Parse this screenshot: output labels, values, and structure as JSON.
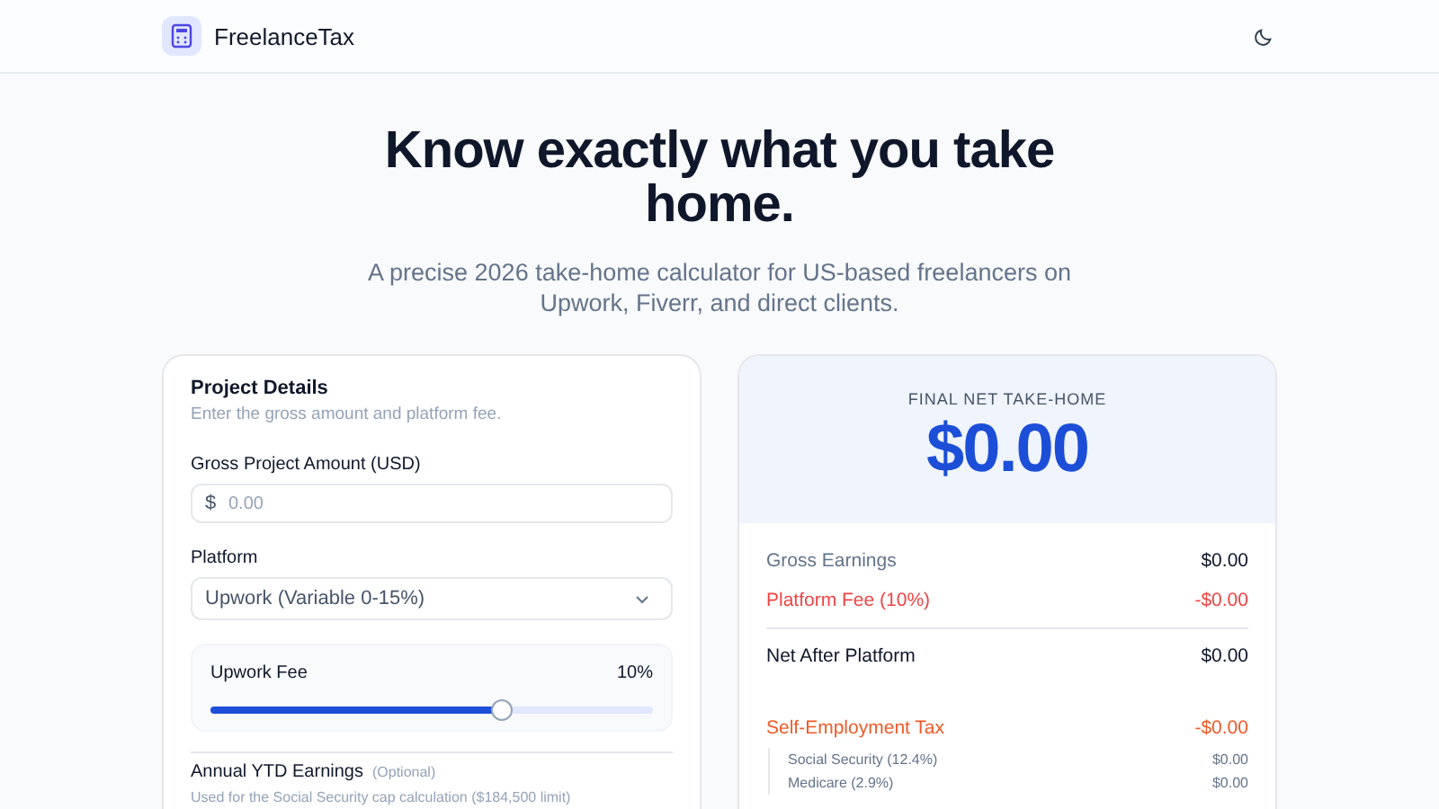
{
  "header": {
    "brand": "FreelanceTax"
  },
  "hero": {
    "title": "Know exactly what you take home.",
    "subtitle": "A precise 2026 take-home calculator for US-based freelancers on Upwork, Fiverr, and direct clients."
  },
  "details": {
    "title": "Project Details",
    "subtitle": "Enter the gross amount and platform fee.",
    "gross": {
      "label": "Gross Project Amount (USD)",
      "prefix": "$",
      "placeholder": "0.00"
    },
    "platform": {
      "label": "Platform",
      "value": "Upwork (Variable 0-15%)"
    },
    "fee": {
      "label": "Upwork Fee",
      "reading": "10%",
      "level": 0.66
    },
    "ytd": {
      "label": "Annual YTD Earnings",
      "tag": "(Optional)",
      "hint": "Used for the Social Security cap calculation ($184,500 limit)"
    }
  },
  "result": {
    "caption": "FINAL NET TAKE-HOME",
    "amount": "$0.00",
    "rows": [
      {
        "kind": "plain",
        "label": "Gross Earnings",
        "value": "$0.00"
      },
      {
        "kind": "fee",
        "label": "Platform Fee (10%)",
        "value": "-$0.00"
      },
      {
        "kind": "total",
        "label": "Net After Platform",
        "value": "$0.00"
      },
      {
        "kind": "tax",
        "label": "Self-Employment Tax",
        "value": "-$0.00"
      },
      {
        "kind": "sub",
        "label": "Social Security (12.4%)",
        "value": "$0.00"
      },
      {
        "kind": "sub",
        "label": "Medicare (2.9%)",
        "value": "$0.00"
      }
    ]
  }
}
